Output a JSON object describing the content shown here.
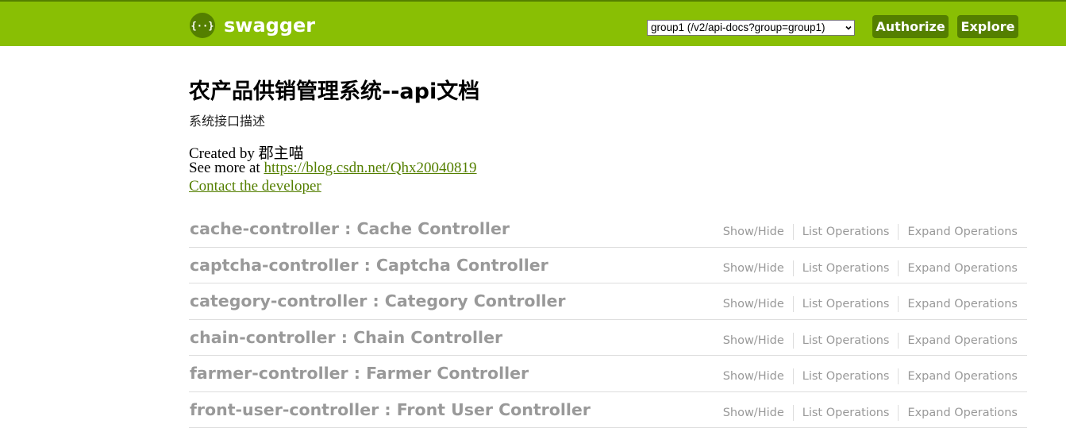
{
  "header": {
    "brand": "swagger",
    "group_select": "group1 (/v2/api-docs?group=group1)",
    "authorize_label": "Authorize",
    "explore_label": "Explore",
    "colors": {
      "bar": "#89bf04",
      "button": "#547f00"
    }
  },
  "info": {
    "title": "农产品供销管理系统--api文档",
    "description": "系统接口描述",
    "created_by": "Created by 郡主喵",
    "see_more_prefix": "See more at ",
    "see_more_url": "https://blog.csdn.net/Qhx20040819",
    "contact": "Contact the developer"
  },
  "operations_labels": {
    "show_hide": "Show/Hide",
    "list": "List Operations",
    "expand": "Expand Operations"
  },
  "resources": [
    {
      "name": "cache-controller : Cache Controller"
    },
    {
      "name": "captcha-controller : Captcha Controller"
    },
    {
      "name": "category-controller : Category Controller"
    },
    {
      "name": "chain-controller : Chain Controller"
    },
    {
      "name": "farmer-controller : Farmer Controller"
    },
    {
      "name": "front-user-controller : Front User Controller"
    }
  ]
}
